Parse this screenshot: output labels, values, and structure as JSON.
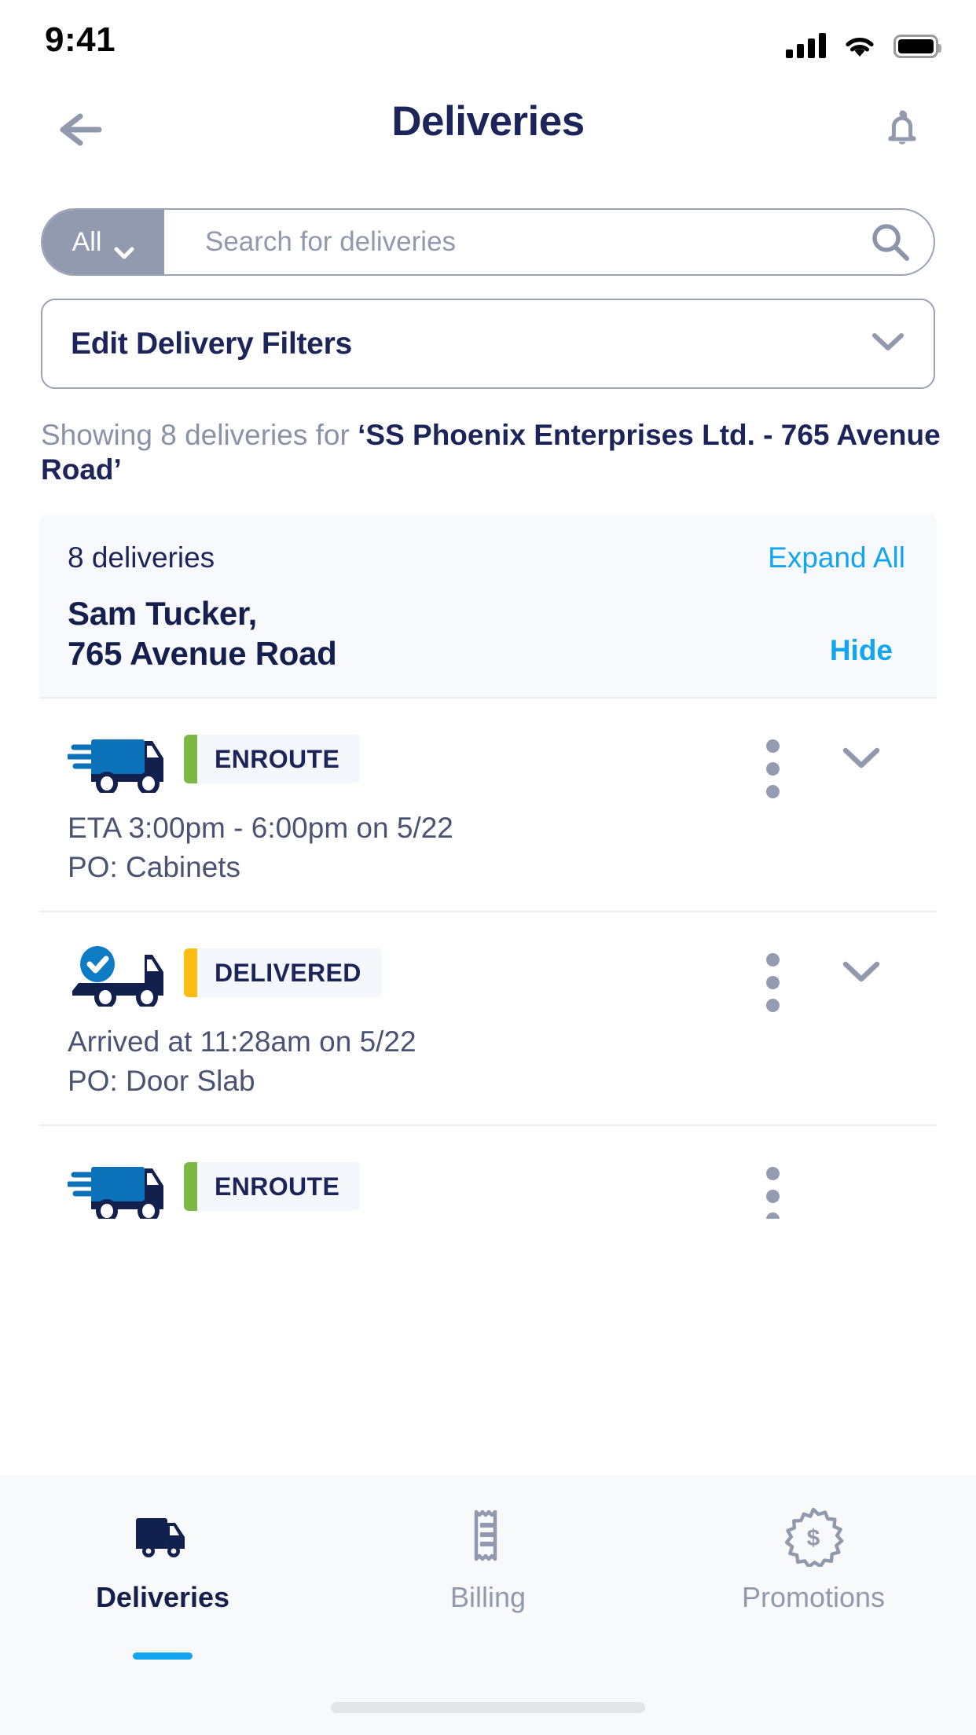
{
  "status_bar": {
    "time": "9:41",
    "icons": [
      "cellular-signal-icon",
      "wifi-icon",
      "battery-icon"
    ]
  },
  "header": {
    "title": "Deliveries",
    "back_icon": "arrow-left-icon",
    "notification_icon": "bell-icon"
  },
  "search": {
    "filter_label": "All",
    "filter_chevron_icon": "chevron-down-icon",
    "placeholder": "Search for deliveries",
    "value": "",
    "search_icon": "search-icon"
  },
  "filters": {
    "label": "Edit Delivery Filters",
    "chevron_icon": "chevron-down-icon"
  },
  "showing": {
    "prefix": "Showing 8 deliveries for ",
    "target": "‘SS Phoenix Enterprises Ltd. - 765 Avenue Road’"
  },
  "group_card": {
    "count_label": "8 deliveries",
    "expand_all_label": "Expand All",
    "customer_name": "Sam Tucker,",
    "customer_address": "765 Avenue Road",
    "hide_label": "Hide"
  },
  "deliveries": [
    {
      "status": "ENROUTE",
      "status_color": "#7cb943",
      "truck_icon": "truck-loaded-icon",
      "line1": "ETA 3:00pm - 6:00pm on 5/22",
      "line2": "PO: Cabinets",
      "menu_icon": "kebab-menu-icon",
      "chevron_icon": "chevron-down-icon"
    },
    {
      "status": "DELIVERED",
      "status_color": "#fbbd11",
      "truck_icon": "truck-delivered-icon",
      "line1": "Arrived at 11:28am on 5/22",
      "line2": "PO: Door Slab",
      "menu_icon": "kebab-menu-icon",
      "chevron_icon": "chevron-down-icon"
    },
    {
      "status": "ENROUTE",
      "status_color": "#7cb943",
      "truck_icon": "truck-loaded-icon",
      "line1": "",
      "line2": "",
      "menu_icon": "kebab-menu-icon",
      "chevron_icon": "chevron-down-icon"
    }
  ],
  "bottom_nav": {
    "items": [
      {
        "label": "Deliveries",
        "icon": "truck-icon",
        "active": true
      },
      {
        "label": "Billing",
        "icon": "receipt-icon",
        "active": false
      },
      {
        "label": "Promotions",
        "icon": "dollar-badge-icon",
        "active": false
      }
    ]
  },
  "colors": {
    "accent_blue": "#13a5f0",
    "navy": "#13204d",
    "muted": "#9199ae",
    "truck_blue": "#0b72b9",
    "green": "#7cb943",
    "yellow": "#fbbd11"
  }
}
